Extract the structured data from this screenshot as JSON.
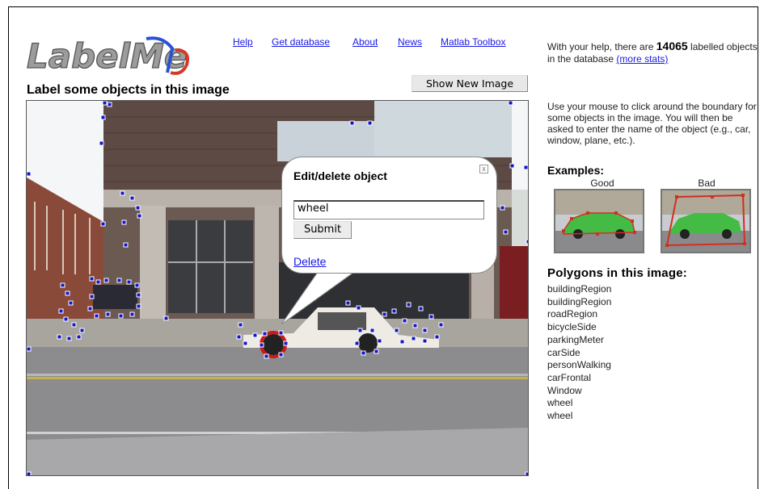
{
  "nav": {
    "links": [
      "Help",
      "Get database",
      "About",
      "News",
      "Matlab Toolbox"
    ]
  },
  "logo": {
    "text": "LabelMe",
    "colors": [
      "#9c9c9c",
      "#2a52d6",
      "#d43a2a"
    ]
  },
  "page": {
    "title": "Label some objects in this image",
    "show_new_image": "Show New Image"
  },
  "popup": {
    "title": "Edit/delete object",
    "close": "x",
    "input_value": "wheel",
    "submit": "Submit",
    "delete": "Delete"
  },
  "sidebar": {
    "stats_prefix": "With your help, there are",
    "count": "14065",
    "stats_suffix": "labelled objects in the database",
    "more_stats": "(more stats)",
    "instructions": "Use your mouse to click around the boundary for some objects in the image. You will then be asked to enter the name of the object (e.g., car, window, plane, etc.).",
    "examples_title": "Examples:",
    "good_label": "Good",
    "bad_label": "Bad",
    "polygons_title": "Polygons in this image:",
    "polygons": [
      "buildingRegion",
      "buildingRegion",
      "roadRegion",
      "bicycleSide",
      "parkingMeter",
      "carSide",
      "personWalking",
      "carFrontal",
      "Window",
      "wheel",
      "wheel"
    ]
  },
  "colors": {
    "link": "#1a1ae6",
    "polygon_point": "#1414c8",
    "selected_outline": "#d01818"
  }
}
